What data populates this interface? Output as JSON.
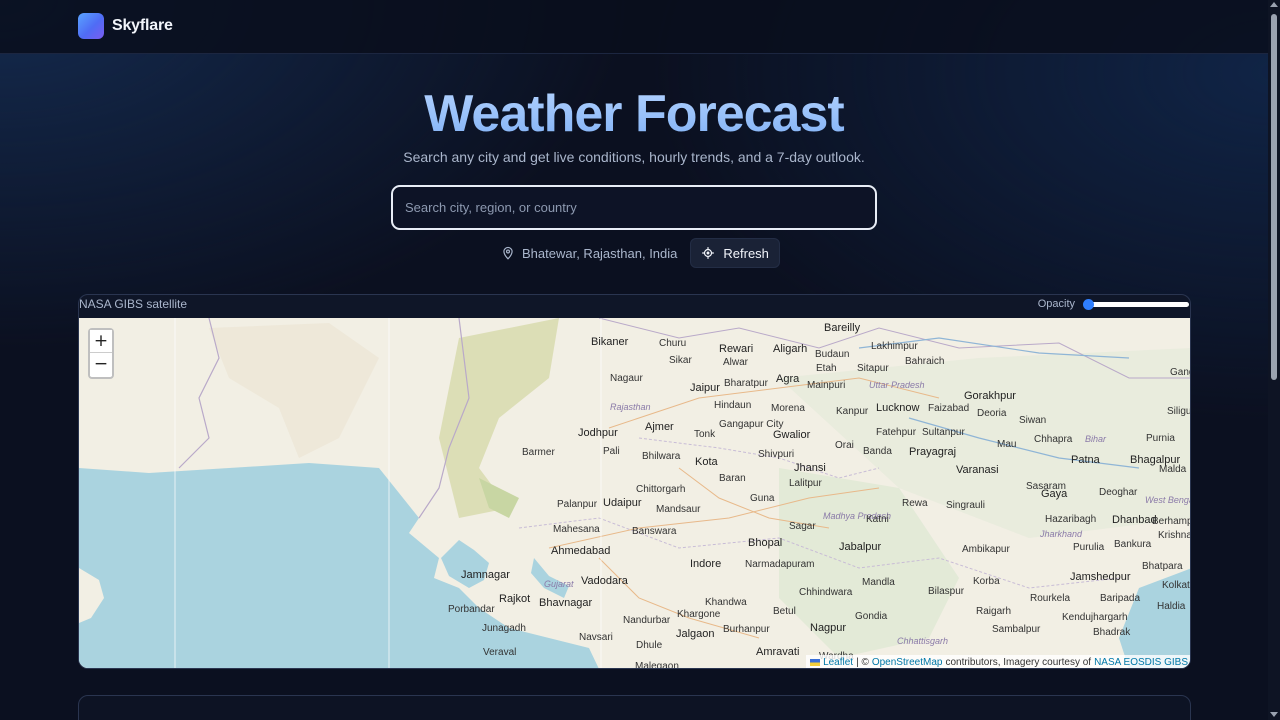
{
  "brand": {
    "name": "Skyflare"
  },
  "hero": {
    "title": "Weather Forecast",
    "subtitle": "Search any city and get live conditions, hourly trends, and a 7-day outlook."
  },
  "search": {
    "placeholder": "Search city, region, or country",
    "value": ""
  },
  "location": {
    "text": "Bhatewar, Rajasthan, India",
    "refresh_label": "Refresh"
  },
  "map": {
    "layer_label": "NASA GIBS satellite",
    "opacity_label": "Opacity",
    "opacity_value": 0,
    "zoom_in": "+",
    "zoom_out": "−",
    "attribution": {
      "leaflet": "Leaflet",
      "sep": "| ©",
      "osm": "OpenStreetMap",
      "middle": "contributors, Imagery courtesy of",
      "nasa": "NASA EOSDIS GIBS"
    },
    "cities": [
      "Bikaner",
      "Churu",
      "Rewari",
      "Aligarh",
      "Bareilly",
      "Lakhimpur",
      "Bahraich",
      "Budaun",
      "Sikar",
      "Alwar",
      "Etah",
      "Sitapur",
      "Nagaur",
      "Jaipur",
      "Bharatpur",
      "Agra",
      "Mainpuri",
      "Uttar Pradesh",
      "Gorakhpur",
      "Lucknow",
      "Faizabad",
      "Deoria",
      "Rajasthan",
      "Hindaun",
      "Morena",
      "Kanpur",
      "Siwan",
      "Ajmer",
      "Tonk",
      "Gwalior",
      "Fatehpur",
      "Sultanpur",
      "Chhapra",
      "Bihar",
      "Purnia",
      "Jodhpur",
      "Gangapur City",
      "Orai",
      "Banda",
      "Prayagraj",
      "Patna",
      "Barmer",
      "Pali",
      "Bhilwara",
      "Shivpuri",
      "Jhansi",
      "Mau",
      "Bhagalpur",
      "Kota",
      "Lalitpur",
      "Rewa",
      "Varanasi",
      "Sasaram",
      "Chittorgarh",
      "Baran",
      "Guna",
      "Gaya",
      "Deoghar",
      "Palanpur",
      "Udaipur",
      "Mandsaur",
      "Madhya Pradesh",
      "Katni",
      "Singrauli",
      "Hazaribagh",
      "Dhanbad",
      "Mahesana",
      "Banswara",
      "Sagar",
      "Jharkhand",
      "Purulia",
      "Bankura",
      "Ahmedabad",
      "Bhopal",
      "Jabalpur",
      "Ambikapur",
      "Indore",
      "Narmadapuram",
      "Jamnagar",
      "Vadodara",
      "Chhindwara",
      "Mandla",
      "Bilaspur",
      "Jamshedpur",
      "Gujarat",
      "Khandwa",
      "Korba",
      "Rourkela",
      "Baripada",
      "Rajkot",
      "Bhavnagar",
      "Khargone",
      "Betul",
      "Gondia",
      "Raigarh",
      "Porbandar",
      "Nandurbar",
      "Burhanpur",
      "Nagpur",
      "Kendujhargarh",
      "Junagadh",
      "Jalgaon",
      "Chhattisgarh",
      "Sambalpur",
      "Navsari",
      "Dhule",
      "Amravati",
      "Wardha",
      "Veraval",
      "Malegaon",
      "Bhadrak",
      "West Bengal",
      "Krishnan",
      "Bhatpara",
      "Kolkata",
      "Haldia",
      "Berhampo",
      "Malda",
      "Siligu",
      "Gang"
    ]
  },
  "colors": {
    "accent": "#2f7fff",
    "title": "#9cc4ff",
    "background": "#0b1020",
    "water": "#aad3df",
    "land": "#f2efe4"
  }
}
